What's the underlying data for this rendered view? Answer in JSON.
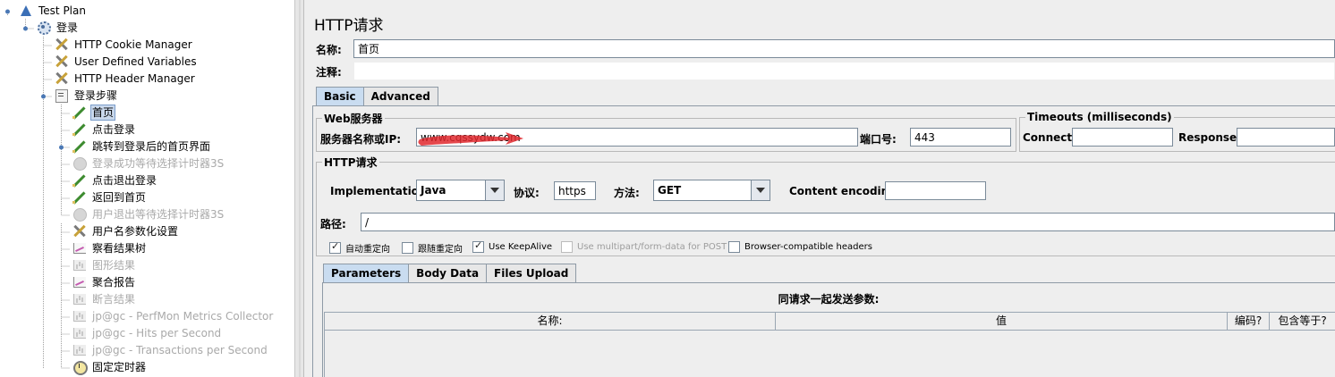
{
  "tree": {
    "nodes": [
      {
        "label": "Test Plan",
        "icon": "plan-icon",
        "disabled": false
      },
      {
        "label": "登录",
        "icon": "thread-group-icon",
        "disabled": false
      },
      {
        "label": "HTTP Cookie Manager",
        "icon": "config-tool-icon",
        "disabled": false
      },
      {
        "label": "User Defined Variables",
        "icon": "config-tool-icon",
        "disabled": false
      },
      {
        "label": "HTTP Header Manager",
        "icon": "config-tool-icon",
        "disabled": false
      },
      {
        "label": "登录步骤",
        "icon": "controller-icon",
        "disabled": false
      },
      {
        "label": "首页",
        "icon": "sampler-icon",
        "disabled": false,
        "selected": true
      },
      {
        "label": "点击登录",
        "icon": "sampler-icon",
        "disabled": false
      },
      {
        "label": "跳转到登录后的首页界面",
        "icon": "sampler-icon",
        "disabled": false
      },
      {
        "label": "登录成功等待选择计时器3S",
        "icon": "timer-icon",
        "disabled": true
      },
      {
        "label": "点击退出登录",
        "icon": "sampler-icon",
        "disabled": false
      },
      {
        "label": "返回到首页",
        "icon": "sampler-icon",
        "disabled": false
      },
      {
        "label": "用户退出等待选择计时器3S",
        "icon": "timer-icon",
        "disabled": true
      },
      {
        "label": "用户名参数化设置",
        "icon": "config-tool-icon",
        "disabled": false
      },
      {
        "label": "察看结果树",
        "icon": "listener-icon",
        "disabled": false
      },
      {
        "label": "图形结果",
        "icon": "listener-icon",
        "disabled": true
      },
      {
        "label": "聚合报告",
        "icon": "listener-icon",
        "disabled": false
      },
      {
        "label": "断言结果",
        "icon": "listener-icon",
        "disabled": true
      },
      {
        "label": "jp@gc - PerfMon Metrics Collector",
        "icon": "listener-icon",
        "disabled": true
      },
      {
        "label": "jp@gc - Hits per Second",
        "icon": "listener-icon",
        "disabled": true
      },
      {
        "label": "jp@gc - Transactions per Second",
        "icon": "listener-icon",
        "disabled": true
      },
      {
        "label": "固定定时器",
        "icon": "timer-icon",
        "disabled": false
      }
    ]
  },
  "panel": {
    "title": "HTTP请求",
    "name_label": "名称:",
    "name_value": "首页",
    "comment_label": "注释:",
    "comment_value": "",
    "tabs": [
      "Basic",
      "Advanced"
    ],
    "web_server": {
      "legend": "Web服务器",
      "server_label": "服务器名称或IP:",
      "server_value": "www.cqssydw.com",
      "port_label": "端口号:",
      "port_value": "443"
    },
    "timeouts": {
      "legend": "Timeouts (milliseconds)",
      "connect_label": "Connect:",
      "connect_value": "",
      "response_label": "Response:",
      "response_value": ""
    },
    "http_request": {
      "legend": "HTTP请求",
      "implementation_label": "Implementation:",
      "implementation_value": "Java",
      "protocol_label": "协议:",
      "protocol_value": "https",
      "method_label": "方法:",
      "method_value": "GET",
      "encoding_label": "Content encoding:",
      "encoding_value": "",
      "path_label": "路径:",
      "path_value": "/"
    },
    "checkboxes": [
      {
        "label": "自动重定向",
        "checked": true,
        "disabled": false
      },
      {
        "label": "跟随重定向",
        "checked": false,
        "disabled": false
      },
      {
        "label": "Use KeepAlive",
        "checked": true,
        "disabled": false
      },
      {
        "label": "Use multipart/form-data for POST",
        "checked": false,
        "disabled": true
      },
      {
        "label": "Browser-compatible headers",
        "checked": false,
        "disabled": false
      }
    ],
    "param_tabs": [
      "Parameters",
      "Body Data",
      "Files Upload"
    ],
    "params_caption": "同请求一起发送参数:",
    "params_columns": [
      "名称:",
      "值",
      "编码?",
      "包含等于?"
    ],
    "annotation_color": "#e0282e"
  }
}
